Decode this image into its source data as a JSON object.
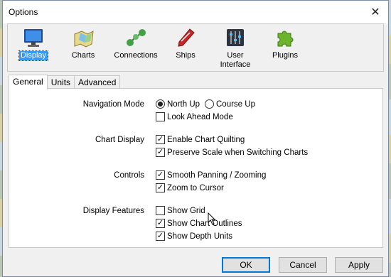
{
  "window": {
    "title": "Options"
  },
  "toolbar": {
    "items": [
      {
        "label": "Display",
        "icon": "monitor-icon"
      },
      {
        "label": "Charts",
        "icon": "charts-icon"
      },
      {
        "label": "Connections",
        "icon": "connections-icon"
      },
      {
        "label": "Ships",
        "icon": "ship-icon"
      },
      {
        "label": "User\nInterface",
        "icon": "sliders-icon"
      },
      {
        "label": "Plugins",
        "icon": "puzzle-icon"
      }
    ],
    "active": "Display"
  },
  "tabs": [
    {
      "label": "General",
      "active": true
    },
    {
      "label": "Units",
      "active": false
    },
    {
      "label": "Advanced",
      "active": false
    }
  ],
  "general": {
    "navigation_mode": {
      "label": "Navigation Mode",
      "north_up": "North Up",
      "course_up": "Course Up",
      "look_ahead": "Look Ahead Mode",
      "selected": "North Up",
      "look_ahead_checked": false
    },
    "chart_display": {
      "label": "Chart Display",
      "quilting": "Enable Chart Quilting",
      "quilting_checked": true,
      "preserve": "Preserve Scale when Switching Charts",
      "preserve_checked": true
    },
    "controls": {
      "label": "Controls",
      "smooth": "Smooth Panning / Zooming",
      "smooth_checked": true,
      "zoom": "Zoom to Cursor",
      "zoom_checked": true
    },
    "display_features": {
      "label": "Display Features",
      "grid": "Show Grid",
      "grid_checked": false,
      "outlines": "Show Chart Outlines",
      "outlines_checked": true,
      "depth": "Show Depth Units",
      "depth_checked": true
    }
  },
  "buttons": {
    "ok": "OK",
    "cancel": "Cancel",
    "apply": "Apply"
  },
  "colors": {
    "accent": "#3399ff",
    "default_border": "#0078d7"
  }
}
